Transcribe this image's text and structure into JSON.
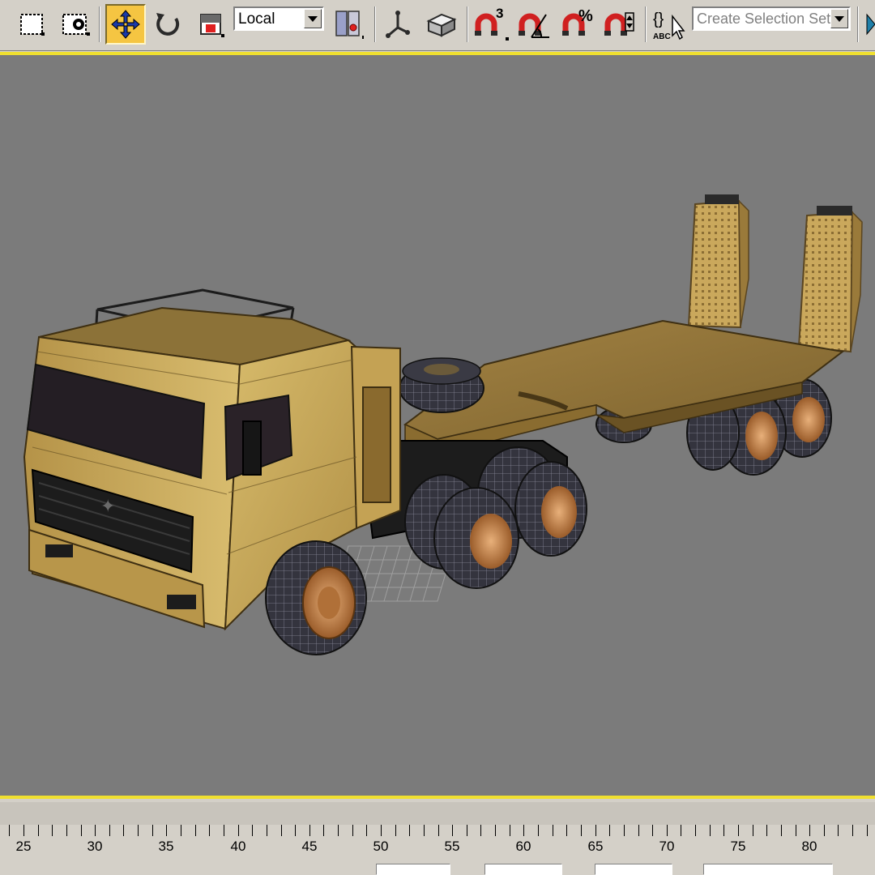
{
  "toolbar": {
    "buttons": [
      {
        "id": "select-region",
        "icon": "select-region-icon"
      },
      {
        "id": "window-crossing",
        "icon": "window-crossing-icon"
      },
      {
        "id": "select-and-move",
        "icon": "move-icon",
        "active": true
      },
      {
        "id": "select-and-rotate",
        "icon": "rotate-icon"
      },
      {
        "id": "select-and-scale",
        "icon": "scale-icon"
      },
      {
        "id": "use-pivot-center",
        "icon": "pivot-center-icon"
      },
      {
        "id": "select-manipulate",
        "icon": "manipulate-icon"
      },
      {
        "id": "keyboard-shortcut-override",
        "icon": "keyboard-override-icon"
      },
      {
        "id": "snaps-toggle",
        "icon": "snap-3-icon"
      },
      {
        "id": "angle-snap",
        "icon": "angle-snap-icon"
      },
      {
        "id": "percent-snap",
        "icon": "percent-snap-icon"
      },
      {
        "id": "spinner-snap",
        "icon": "spinner-snap-icon"
      },
      {
        "id": "edit-named-selection",
        "icon": "named-selection-icon"
      },
      {
        "id": "mirror",
        "icon": "mirror-icon"
      }
    ],
    "coordinate_system": "Local",
    "named_selection_placeholder": "Create Selection Set"
  },
  "viewport": {
    "background": "#7b7b7b",
    "border_color": "#f0e030",
    "model": "flatbed-truck-with-trailer"
  },
  "timeline": {
    "labels": [
      "25",
      "30",
      "35",
      "40",
      "45",
      "50",
      "55",
      "60",
      "65",
      "70",
      "75",
      "80"
    ]
  },
  "colors": {
    "toolbar_bg": "#d4d0c8",
    "active_button": "#f5c542",
    "truck_body": "#c9a85a",
    "tire": "#2e2e38",
    "hub": "#c98a4e"
  }
}
